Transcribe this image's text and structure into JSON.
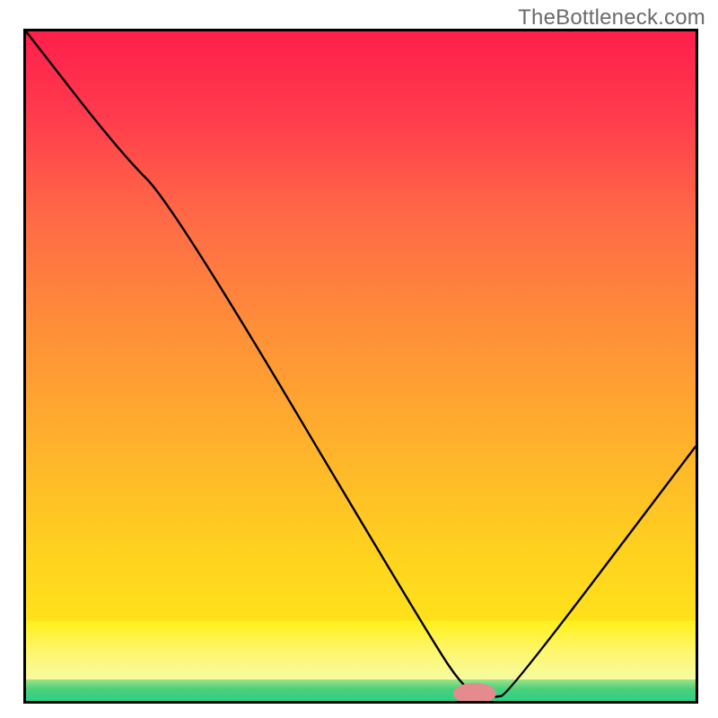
{
  "watermark": "TheBottleneck.com",
  "chart_data": {
    "type": "line",
    "title": "",
    "xlabel": "",
    "ylabel": "",
    "xlim": [
      0,
      100
    ],
    "ylim": [
      0,
      100
    ],
    "x": [
      0,
      14,
      22,
      60,
      66,
      70,
      72,
      100
    ],
    "values": [
      100,
      82,
      74,
      10,
      1,
      0.5,
      1,
      38
    ],
    "marker": {
      "x": 67,
      "y": 1.1,
      "color": "#e58b8d",
      "rx": 3.2,
      "ry": 1.6
    },
    "green_band": {
      "from": 0,
      "to": 3.2
    },
    "yellow_band": {
      "from": 3.2,
      "to": 12
    }
  }
}
